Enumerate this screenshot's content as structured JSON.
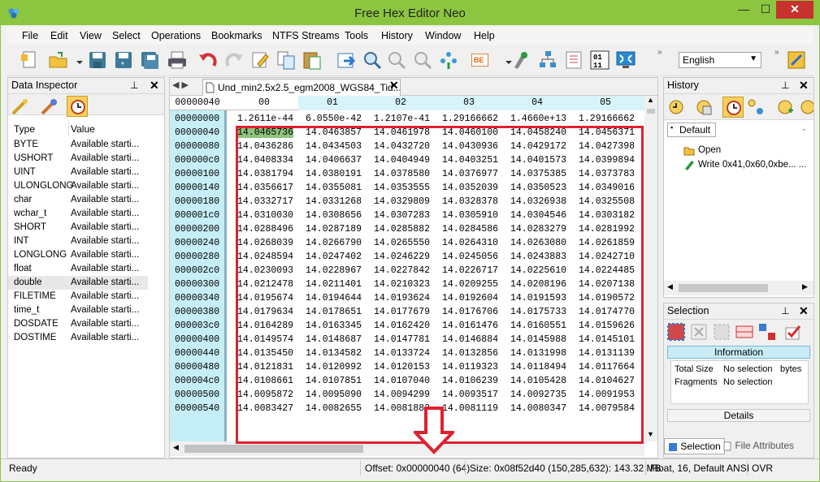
{
  "window": {
    "title": "Free Hex Editor Neo",
    "min": "—",
    "max": "☐",
    "close": "✕"
  },
  "menu": [
    "File",
    "Edit",
    "View",
    "Select",
    "Operations",
    "Bookmarks",
    "NTFS Streams",
    "Tools",
    "History",
    "Window",
    "Help"
  ],
  "toolbar": {
    "language": "English",
    "be_label": "BE",
    "bin_label": "01\n11"
  },
  "data_inspector": {
    "title": "Data Inspector",
    "col_type": "Type",
    "col_value": "Value",
    "rows": [
      {
        "type": "BYTE",
        "value": "Available starti..."
      },
      {
        "type": "USHORT",
        "value": "Available starti..."
      },
      {
        "type": "UINT",
        "value": "Available starti..."
      },
      {
        "type": "ULONGLONG",
        "value": "Available starti..."
      },
      {
        "type": "char",
        "value": "Available starti..."
      },
      {
        "type": "wchar_t",
        "value": "Available starti..."
      },
      {
        "type": "SHORT",
        "value": "Available starti..."
      },
      {
        "type": "INT",
        "value": "Available starti..."
      },
      {
        "type": "LONGLONG",
        "value": "Available starti..."
      },
      {
        "type": "float",
        "value": "Available starti..."
      },
      {
        "type": "double",
        "value": "Available starti..."
      },
      {
        "type": "FILETIME",
        "value": "Available starti..."
      },
      {
        "type": "time_t",
        "value": "Available starti..."
      },
      {
        "type": "DOSDATE",
        "value": "Available starti..."
      },
      {
        "type": "DOSTIME",
        "value": "Available starti..."
      }
    ]
  },
  "editor": {
    "tab_label": "Und_min2.5x2.5_egm2008_WGS84_Tid...",
    "header_addr": "00000040",
    "columns": [
      "00",
      "01",
      "02",
      "03",
      "04",
      "05"
    ],
    "rows": [
      {
        "addr": "00000000",
        "cells": [
          "1.2611e-44",
          "6.0550e-42",
          "1.2107e-41",
          "1.29166662",
          "1.4660e+13",
          "1.29166662"
        ]
      },
      {
        "addr": "00000040",
        "cells": [
          "14.0465736",
          "14.0463857",
          "14.0461978",
          "14.0460100",
          "14.0458240",
          "14.0456371"
        ]
      },
      {
        "addr": "00000080",
        "cells": [
          "14.0436286",
          "14.0434503",
          "14.0432720",
          "14.0430936",
          "14.0429172",
          "14.0427398"
        ]
      },
      {
        "addr": "000000c0",
        "cells": [
          "14.0408334",
          "14.0406637",
          "14.0404949",
          "14.0403251",
          "14.0401573",
          "14.0399894"
        ]
      },
      {
        "addr": "00000100",
        "cells": [
          "14.0381794",
          "14.0380191",
          "14.0378580",
          "14.0376977",
          "14.0375385",
          "14.0373783"
        ]
      },
      {
        "addr": "00000140",
        "cells": [
          "14.0356617",
          "14.0355081",
          "14.0353555",
          "14.0352039",
          "14.0350523",
          "14.0349016"
        ]
      },
      {
        "addr": "00000180",
        "cells": [
          "14.0332717",
          "14.0331268",
          "14.0329809",
          "14.0328378",
          "14.0326938",
          "14.0325508"
        ]
      },
      {
        "addr": "000001c0",
        "cells": [
          "14.0310030",
          "14.0308656",
          "14.0307283",
          "14.0305910",
          "14.0304546",
          "14.0303182"
        ]
      },
      {
        "addr": "00000200",
        "cells": [
          "14.0288496",
          "14.0287189",
          "14.0285882",
          "14.0284586",
          "14.0283279",
          "14.0281992"
        ]
      },
      {
        "addr": "00000240",
        "cells": [
          "14.0268039",
          "14.0266790",
          "14.0265550",
          "14.0264310",
          "14.0263080",
          "14.0261859"
        ]
      },
      {
        "addr": "00000280",
        "cells": [
          "14.0248594",
          "14.0247402",
          "14.0246229",
          "14.0245056",
          "14.0243883",
          "14.0242710"
        ]
      },
      {
        "addr": "000002c0",
        "cells": [
          "14.0230093",
          "14.0228967",
          "14.0227842",
          "14.0226717",
          "14.0225610",
          "14.0224485"
        ]
      },
      {
        "addr": "00000300",
        "cells": [
          "14.0212478",
          "14.0211401",
          "14.0210323",
          "14.0209255",
          "14.0208196",
          "14.0207138"
        ]
      },
      {
        "addr": "00000340",
        "cells": [
          "14.0195674",
          "14.0194644",
          "14.0193624",
          "14.0192604",
          "14.0191593",
          "14.0190572"
        ]
      },
      {
        "addr": "00000380",
        "cells": [
          "14.0179634",
          "14.0178651",
          "14.0177679",
          "14.0176706",
          "14.0175733",
          "14.0174770"
        ]
      },
      {
        "addr": "000003c0",
        "cells": [
          "14.0164289",
          "14.0163345",
          "14.0162420",
          "14.0161476",
          "14.0160551",
          "14.0159626"
        ]
      },
      {
        "addr": "00000400",
        "cells": [
          "14.0149574",
          "14.0148687",
          "14.0147781",
          "14.0146884",
          "14.0145988",
          "14.0145101"
        ]
      },
      {
        "addr": "00000440",
        "cells": [
          "14.0135450",
          "14.0134582",
          "14.0133724",
          "14.0132856",
          "14.0131998",
          "14.0131139"
        ]
      },
      {
        "addr": "00000480",
        "cells": [
          "14.0121831",
          "14.0120992",
          "14.0120153",
          "14.0119323",
          "14.0118494",
          "14.0117664"
        ]
      },
      {
        "addr": "000004c0",
        "cells": [
          "14.0108661",
          "14.0107851",
          "14.0107040",
          "14.0106239",
          "14.0105428",
          "14.0104627"
        ]
      },
      {
        "addr": "00000500",
        "cells": [
          "14.0095872",
          "14.0095090",
          "14.0094299",
          "14.0093517",
          "14.0092735",
          "14.0091953"
        ]
      },
      {
        "addr": "00000540",
        "cells": [
          "14.0083427",
          "14.0082655",
          "14.0081882",
          "14.0081119",
          "14.0080347",
          "14.0079584"
        ]
      }
    ]
  },
  "history": {
    "title": "History",
    "tab": "Default",
    "items": [
      "Open",
      "Write 0x41,0x60,0xbe... ..."
    ]
  },
  "selection": {
    "title": "Selection",
    "info_header": "Information",
    "total_size_label": "Total Size",
    "total_size_value": "No selection",
    "total_size_unit": "bytes",
    "fragments_label": "Fragments",
    "fragments_value": "No selection",
    "details_header": "Details",
    "tab_selection": "Selection",
    "tab_file_attributes": "File Attributes"
  },
  "status": {
    "ready": "Ready",
    "offset": "Offset: 0x00000040 (64)",
    "size": "Size: 0x08f52d40 (150,285,632): 143.32 MB",
    "format": "Float, 16, Default ANSI",
    "mode": "OVR"
  }
}
